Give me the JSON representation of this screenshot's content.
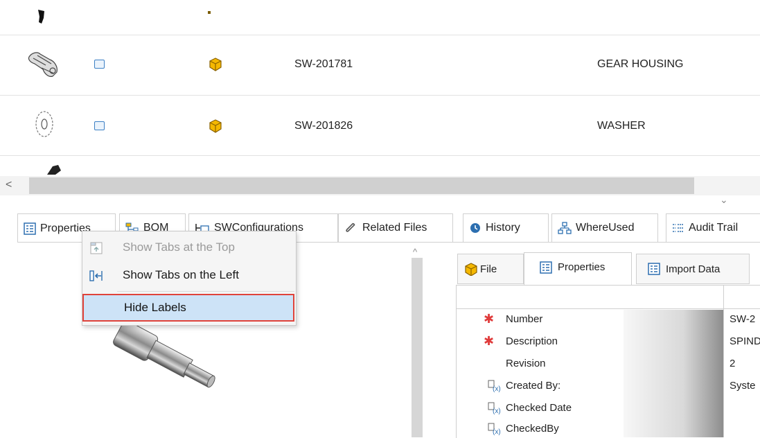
{
  "grid": {
    "rows": [
      {
        "number": "SW-201781",
        "description": "GEAR HOUSING"
      },
      {
        "number": "SW-201826",
        "description": "WASHER"
      }
    ]
  },
  "scrollbar": {
    "left_arrow": "<",
    "collapse_arrow": "⌄"
  },
  "tabs": [
    {
      "label": "Properties",
      "icon": "properties-icon"
    },
    {
      "label": "BOM",
      "icon": "bom-icon"
    },
    {
      "label": "SWConfigurations",
      "icon": "configurations-icon"
    },
    {
      "label": "Related Files",
      "icon": "paperclip-icon"
    },
    {
      "label": "History",
      "icon": "history-icon"
    },
    {
      "label": "WhereUsed",
      "icon": "where-used-icon"
    },
    {
      "label": "Audit Trail",
      "icon": "audit-trail-icon"
    }
  ],
  "context_menu": {
    "items": [
      {
        "label": "Show Tabs at the Top",
        "enabled": false,
        "icon": "tabs-top-icon"
      },
      {
        "label": "Show Tabs on the Left",
        "enabled": true,
        "icon": "tabs-left-icon"
      },
      {
        "label": "Hide Labels",
        "enabled": true,
        "highlighted": true
      }
    ]
  },
  "inner_tabs": [
    {
      "label": "File",
      "icon": "file-icon"
    },
    {
      "label": "Properties",
      "icon": "properties-icon",
      "active": true
    },
    {
      "label": "Import Data",
      "icon": "import-data-icon"
    }
  ],
  "properties": [
    {
      "label": "Number",
      "value": "SW-2",
      "required": true
    },
    {
      "label": "Description",
      "value": "SPIND",
      "required": true
    },
    {
      "label": "Revision",
      "value": "2",
      "required": false
    },
    {
      "label": "Created By:",
      "value": "Syste",
      "required": false,
      "variable": true
    },
    {
      "label": "Checked Date",
      "value": "",
      "required": false,
      "variable": true
    },
    {
      "label": "CheckedBy",
      "value": "",
      "required": false,
      "variable": true
    }
  ],
  "colors": {
    "accent": "#3b7fc4",
    "highlight": "#cde3f7",
    "highlight_border": "#e0433a",
    "required": "#e03b3b"
  }
}
